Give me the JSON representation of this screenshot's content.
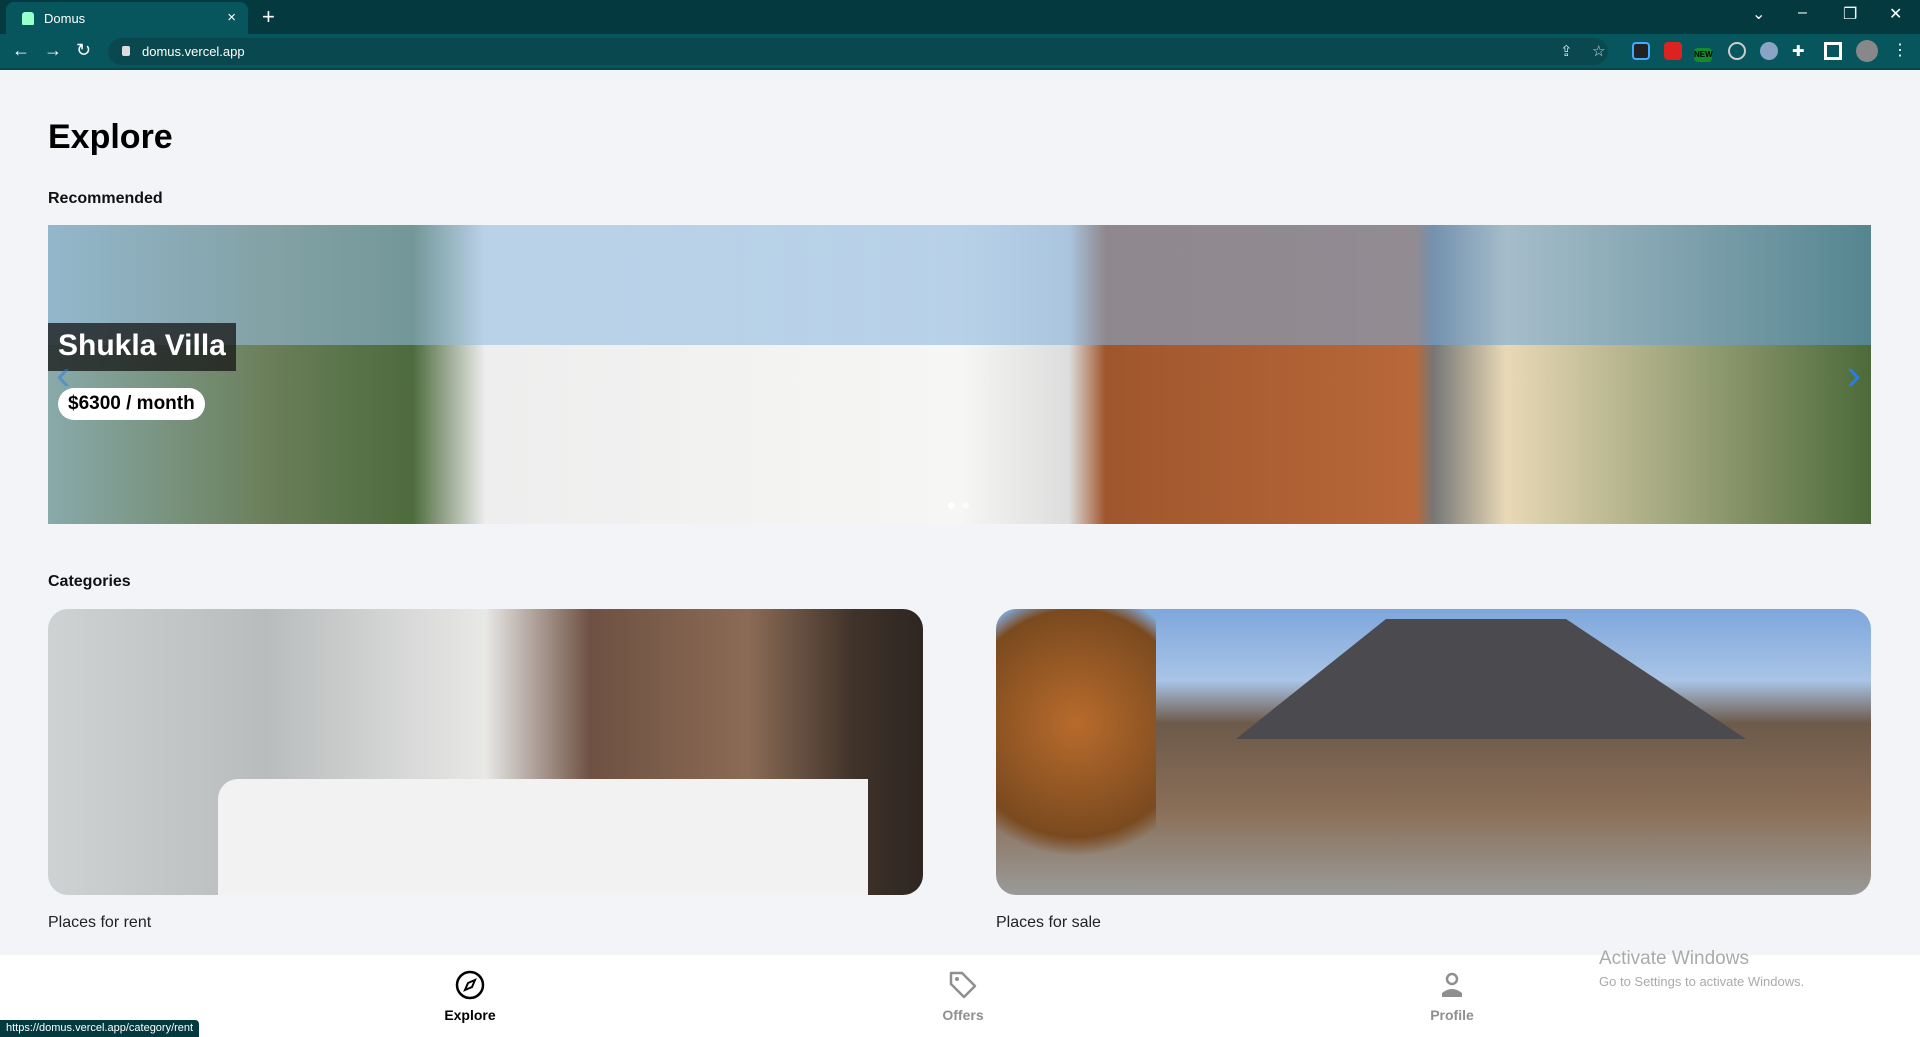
{
  "browser": {
    "tab_title": "Domus",
    "url": "domus.vercel.app",
    "status_url": "https://domus.vercel.app/category/rent",
    "extension_badge": "NEW"
  },
  "page": {
    "title": "Explore",
    "recommended_label": "Recommended",
    "categories_label": "Categories"
  },
  "carousel": {
    "title": "Shukla Villa",
    "price": "$6300 / month",
    "slides": 2,
    "active_slide": 1
  },
  "categories": [
    {
      "label": "Places for rent"
    },
    {
      "label": "Places for sale"
    }
  ],
  "bottom_nav": [
    {
      "label": "Explore",
      "icon": "compass-icon",
      "active": true
    },
    {
      "label": "Offers",
      "icon": "tag-icon",
      "active": false
    },
    {
      "label": "Profile",
      "icon": "person-icon",
      "active": false
    }
  ],
  "watermark": {
    "line1": "Activate Windows",
    "line2": "Go to Settings to activate Windows."
  },
  "colors": {
    "chrome": "#03393f",
    "toolbar": "#08565d",
    "active_nav": "#000000",
    "inactive_nav": "#8f8f8f"
  }
}
